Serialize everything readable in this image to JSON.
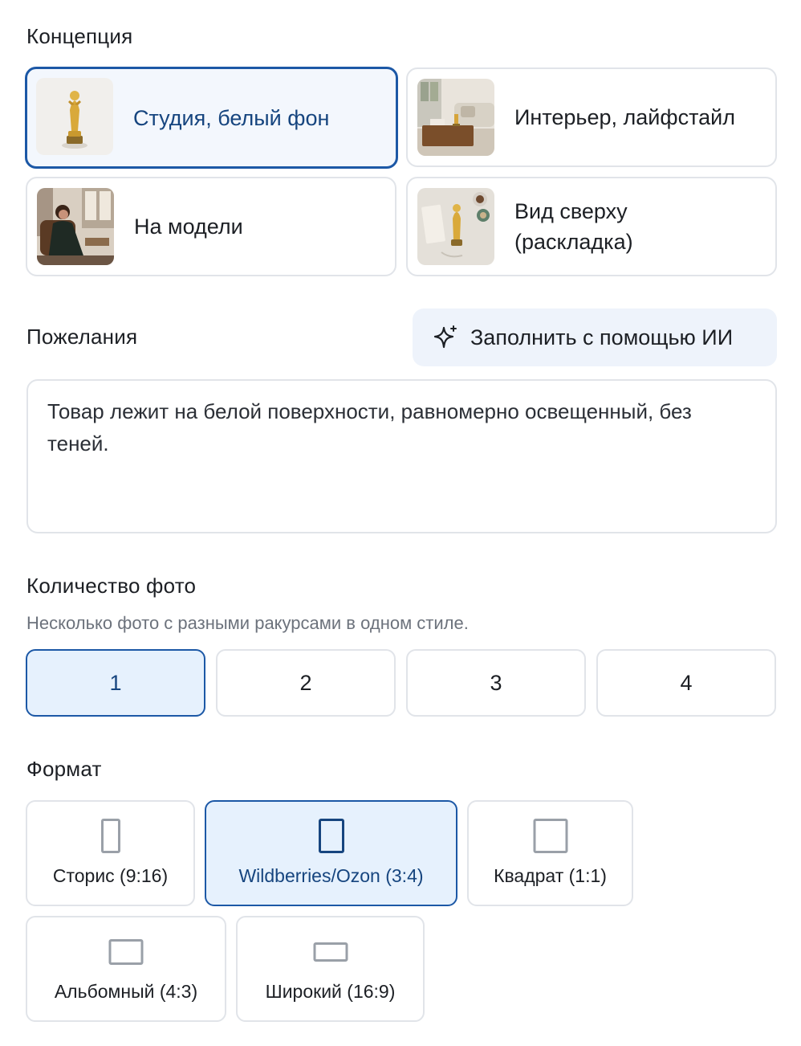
{
  "concept": {
    "title": "Концепция",
    "options": [
      {
        "label": "Студия, белый фон",
        "selected": true,
        "thumb": "trophy-white-background-photo"
      },
      {
        "label": "Интерьер, лайфстайл",
        "selected": false,
        "thumb": "living-room-interior-photo"
      },
      {
        "label": "На модели",
        "selected": false,
        "thumb": "woman-in-armchair-photo"
      },
      {
        "label": "Вид сверху\n(раскладка)",
        "selected": false,
        "thumb": "flatlay-trophy-photo"
      }
    ]
  },
  "wishes": {
    "title": "Пожелания",
    "ai_button_label": "Заполнить с помощью ИИ",
    "ai_button_icon": "sparkle-icon",
    "text": "Товар лежит на белой поверхности, равномерно освещенный, без теней."
  },
  "photo_count": {
    "title": "Количество фото",
    "subtitle": "Несколько фото с разными ракурсами в одном стиле.",
    "options": [
      "1",
      "2",
      "3",
      "4"
    ],
    "selected": "1"
  },
  "format": {
    "title": "Формат",
    "options": [
      {
        "label": "Сторис (9:16)",
        "icon": "portrait-9-16-icon",
        "selected": false
      },
      {
        "label": "Wildberries/Ozon (3:4)",
        "icon": "portrait-3-4-icon",
        "selected": true
      },
      {
        "label": "Квадрат (1:1)",
        "icon": "square-icon",
        "selected": false
      },
      {
        "label": "Альбомный (4:3)",
        "icon": "landscape-4-3-icon",
        "selected": false
      },
      {
        "label": "Широкий (16:9)",
        "icon": "wide-16-9-icon",
        "selected": false
      }
    ]
  },
  "colors": {
    "accent": "#1c58a6",
    "accent_text": "#16457f",
    "selected_bg": "#e6f1fd",
    "border": "#e1e4e9"
  }
}
